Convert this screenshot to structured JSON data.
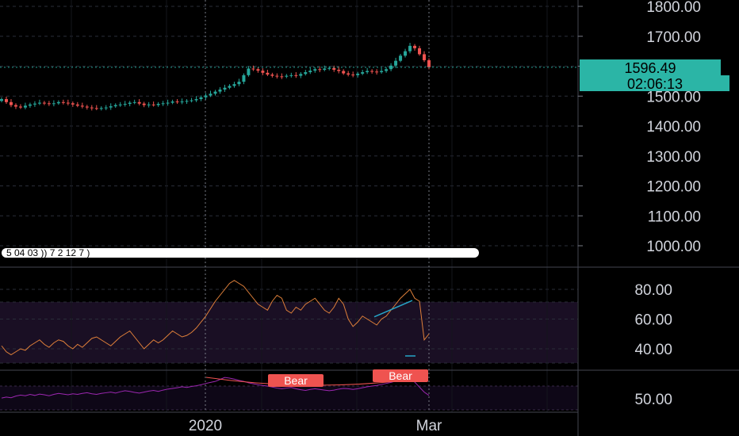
{
  "colors": {
    "background": "#000000",
    "grid": "#2a2e39",
    "up": "#26a69a",
    "down": "#ef5350",
    "rsi_line": "#e0803a",
    "rsi_band": "#1a0f24",
    "osc_line": "#9c27b0",
    "trend_line": "#26a6c8",
    "badge_bg": "#2bb5a6",
    "bear_bg": "#ef5350"
  },
  "price_axis": {
    "ticks": [
      "1800.00",
      "1700.00",
      "1600.00",
      "1500.00",
      "1400.00",
      "1300.00",
      "1200.00",
      "1100.00",
      "1000.00"
    ],
    "last_price": "1596.49",
    "countdown": "02:06:13"
  },
  "rsi_axis": {
    "ticks": [
      "80.00",
      "60.00",
      "40.00"
    ]
  },
  "osc_axis": {
    "ticks": [
      "50.00"
    ]
  },
  "time_axis": {
    "labels": [
      "2020",
      "Mar"
    ]
  },
  "volume_strip": {
    "text": "5 04 03 )) 7 2 12 7 )"
  },
  "labels": {
    "bear_1": "Bear",
    "bear_2": "Bear"
  },
  "chart_data": [
    {
      "type": "candlestick",
      "ylim": [
        950,
        1820
      ],
      "y_ticks": [
        1000,
        1100,
        1200,
        1300,
        1400,
        1500,
        1600,
        1700,
        1800
      ],
      "x_labels": [
        "2020",
        "Mar"
      ],
      "last_price": 1596.49,
      "close": [
        1490,
        1480,
        1470,
        1465,
        1462,
        1468,
        1472,
        1475,
        1478,
        1476,
        1474,
        1476,
        1480,
        1478,
        1476,
        1472,
        1468,
        1465,
        1462,
        1460,
        1458,
        1460,
        1462,
        1466,
        1470,
        1472,
        1474,
        1478,
        1480,
        1475,
        1470,
        1472,
        1470,
        1474,
        1476,
        1478,
        1482,
        1480,
        1482,
        1484,
        1486,
        1490,
        1496,
        1502,
        1508,
        1515,
        1522,
        1528,
        1534,
        1540,
        1548,
        1570,
        1592,
        1590,
        1585,
        1578,
        1572,
        1568,
        1566,
        1565,
        1568,
        1570,
        1568,
        1574,
        1580,
        1585,
        1590,
        1588,
        1592,
        1594,
        1588,
        1584,
        1576,
        1572,
        1570,
        1575,
        1580,
        1584,
        1582,
        1580,
        1584,
        1590,
        1602,
        1618,
        1635,
        1650,
        1668,
        1660,
        1640,
        1620,
        1596.49
      ]
    },
    {
      "type": "line",
      "name": "RSI",
      "ylim": [
        30,
        92
      ],
      "y_ticks": [
        40,
        60,
        80
      ],
      "values": [
        42,
        38,
        36,
        38,
        40,
        39,
        42,
        44,
        46,
        43,
        41,
        44,
        46,
        45,
        42,
        40,
        43,
        41,
        44,
        47,
        48,
        46,
        44,
        42,
        45,
        48,
        50,
        52,
        48,
        44,
        40,
        43,
        46,
        44,
        46,
        49,
        52,
        50,
        48,
        49,
        51,
        54,
        58,
        62,
        67,
        72,
        76,
        80,
        84,
        86,
        84,
        82,
        78,
        74,
        70,
        68,
        66,
        72,
        76,
        74,
        66,
        64,
        68,
        66,
        70,
        72,
        74,
        70,
        66,
        64,
        68,
        74,
        70,
        60,
        55,
        58,
        62,
        60,
        58,
        56,
        60,
        62,
        66,
        70,
        74,
        77,
        80,
        74,
        72,
        46,
        50
      ],
      "annotation_trend": {
        "from": 61.5,
        "to": 72.5
      }
    },
    {
      "type": "line",
      "name": "Oscillator",
      "ylim": [
        44,
        58
      ],
      "y_ticks": [
        50
      ],
      "values": [
        50.2,
        50.5,
        50.3,
        50.8,
        51.1,
        50.9,
        51.3,
        51.0,
        51.4,
        51.2,
        50.9,
        51.3,
        51.6,
        51.4,
        51.2,
        51.5,
        51.3,
        51.6,
        51.8,
        51.5,
        51.3,
        51.6,
        51.8,
        52.0,
        51.7,
        52.1,
        52.4,
        52.2,
        51.9,
        51.7,
        52.0,
        52.3,
        52.5,
        52.2,
        52.6,
        52.9,
        53.1,
        53.3,
        53.6,
        53.4,
        53.7,
        53.9,
        54.2,
        54.6,
        54.9,
        55.2,
        55.8,
        56.4,
        56.2,
        55.9,
        55.5,
        55.2,
        54.8,
        54.5,
        54.2,
        54.0,
        53.8,
        53.5,
        53.2,
        53.0,
        53.2,
        53.4,
        53.0,
        52.7,
        52.5,
        52.8,
        53.0,
        52.8,
        52.6,
        52.4,
        52.6,
        52.9,
        53.1,
        53.0,
        52.8,
        53.0,
        53.3,
        53.6,
        53.8,
        54.0,
        54.3,
        54.6,
        54.9,
        55.3,
        55.8,
        56.4,
        56.0,
        55.0,
        53.5,
        52.0,
        51.0
      ],
      "bear_labels": [
        "Bear",
        "Bear"
      ]
    }
  ]
}
